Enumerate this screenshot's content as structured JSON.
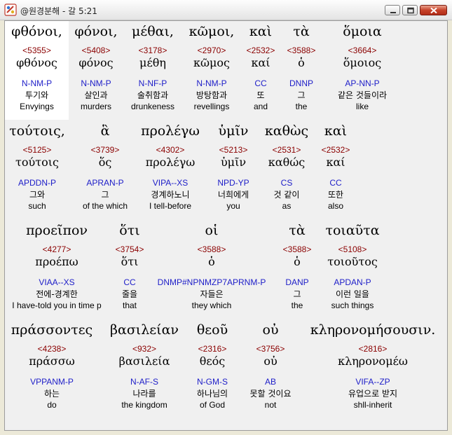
{
  "window": {
    "title": "@원경분해 - 갈 5:21",
    "minimize_icon": "minimize-icon",
    "maximize_icon": "maximize-icon",
    "close_icon": "close-icon"
  },
  "colors": {
    "strong_number": "#8b0000",
    "parsing_code": "#1d1dc8",
    "background": "#f0f0f0",
    "highlight": "#ffffff"
  },
  "rows": [
    {
      "words": [
        {
          "greek": "φθόνοι,",
          "strong": "<5355>",
          "lemma": "φθόνος",
          "parse": "N-NM-P",
          "korean": "투기와",
          "english": "Envyings"
        },
        {
          "greek": "φόνοι,",
          "strong": "<5408>",
          "lemma": "φόνος",
          "parse": "N-NM-P",
          "korean": "살인과",
          "english": "murders"
        },
        {
          "greek": "μέθαι,",
          "strong": "<3178>",
          "lemma": "μέθη",
          "parse": "N-NF-P",
          "korean": "술취함과",
          "english": "drunkeness"
        },
        {
          "greek": "κῶμοι,",
          "strong": "<2970>",
          "lemma": "κῶμος",
          "parse": "N-NM-P",
          "korean": "방탕함과",
          "english": "revellings"
        },
        {
          "greek": "καὶ",
          "strong": "<2532>",
          "lemma": "καί",
          "parse": "CC",
          "korean": "또",
          "english": "and"
        },
        {
          "greek": "τὰ",
          "strong": "<3588>",
          "lemma": "ὁ",
          "parse": "DNNP",
          "korean": "그",
          "english": "the"
        },
        {
          "greek": "ὅμοια",
          "strong": "<3664>",
          "lemma": "ὅμοιος",
          "parse": "AP-NN-P",
          "korean": "같은 것들이라",
          "english": "like"
        }
      ]
    },
    {
      "words": [
        {
          "greek": "τούτοις,",
          "strong": "<5125>",
          "lemma": "τούτοις",
          "parse": "APDDN-P",
          "korean": "그와",
          "english": "such"
        },
        {
          "greek": "ἃ",
          "strong": "<3739>",
          "lemma": "ὅς",
          "parse": "APRAN-P",
          "korean": "그",
          "english": "of the which"
        },
        {
          "greek": "προλέγω",
          "strong": "<4302>",
          "lemma": "προλέγω",
          "parse": "VIPA--XS",
          "korean": "경계하노니",
          "english": "I tell-before"
        },
        {
          "greek": "ὑμῖν",
          "strong": "<5213>",
          "lemma": "ὑμῖν",
          "parse": "NPD-YP",
          "korean": "너희에게",
          "english": "you"
        },
        {
          "greek": "καθὼς",
          "strong": "<2531>",
          "lemma": "καθώς",
          "parse": "CS",
          "korean": "것 같이",
          "english": "as"
        },
        {
          "greek": "καὶ",
          "strong": "<2532>",
          "lemma": "καί",
          "parse": "CC",
          "korean": "또한",
          "english": "also"
        }
      ]
    },
    {
      "words": [
        {
          "greek": "προεῖπον",
          "strong": "<4277>",
          "lemma": "προέπω",
          "parse": "VIAA--XS",
          "korean": "전에-경계한",
          "english": "I have-told you in time p"
        },
        {
          "greek": "ὅτι",
          "strong": "<3754>",
          "lemma": "ὅτι",
          "parse": "CC",
          "korean": "줄을",
          "english": "that"
        },
        {
          "greek": "οἱ",
          "strong": "<3588>",
          "lemma": "ὁ",
          "parse": "DNMP#NPNMZP7APRNM-P",
          "korean": "자들은",
          "english": "they which"
        },
        {
          "greek": "τὰ",
          "strong": "<3588>",
          "lemma": "ὁ",
          "parse": "DANP",
          "korean": "그",
          "english": "the"
        },
        {
          "greek": "τοιαῦτα",
          "strong": "<5108>",
          "lemma": "τοιοῦτος",
          "parse": "APDAN-P",
          "korean": "이런 일을",
          "english": "such things"
        }
      ]
    },
    {
      "words": [
        {
          "greek": "πράσσοντες",
          "strong": "<4238>",
          "lemma": "πράσσω",
          "parse": "VPPANM-P",
          "korean": "하는",
          "english": "do"
        },
        {
          "greek": "βασιλείαν",
          "strong": "<932>",
          "lemma": "βασιλεία",
          "parse": "N-AF-S",
          "korean": "나라를",
          "english": "the kingdom"
        },
        {
          "greek": "θεοῦ",
          "strong": "<2316>",
          "lemma": "θεός",
          "parse": "N-GM-S",
          "korean": "하나님의",
          "english": "of God"
        },
        {
          "greek": "οὐ",
          "strong": "<3756>",
          "lemma": "οὐ",
          "parse": "AB",
          "korean": "못할 것이요",
          "english": "not"
        },
        {
          "greek": "κληρονομήσουσιν.",
          "strong": "<2816>",
          "lemma": "κληρονομέω",
          "parse": "VIFA--ZP",
          "korean": "유업으로 받지",
          "english": "shll-inherit"
        }
      ]
    }
  ]
}
